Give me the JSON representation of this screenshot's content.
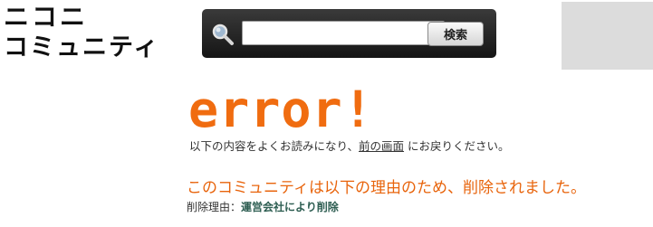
{
  "logo": {
    "line1": "ニコニ",
    "line2": "コミュニティ"
  },
  "search": {
    "value": "",
    "placeholder": "",
    "button_label": "検索",
    "icon": "magnifier-icon"
  },
  "error": {
    "heading": "error!",
    "heading_color": "#f06c10",
    "back_note_before": "以下の内容をよくお読みになり、",
    "back_link": "前の画面",
    "back_note_after": "にお戻りください。"
  },
  "deletion": {
    "message": "このコミュニティは以下の理由のため、削除されました。",
    "message_color": "#e8640c",
    "reason_label": "削除理由：",
    "reason_value": "運営会社により削除"
  }
}
